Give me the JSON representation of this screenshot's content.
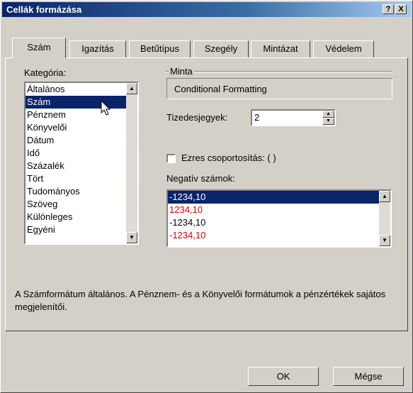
{
  "window": {
    "title": "Cellák formázása",
    "help_label": "?",
    "close_label": "X"
  },
  "tabs": [
    {
      "label": "Szám"
    },
    {
      "label": "Igazítás"
    },
    {
      "label": "Betűtípus"
    },
    {
      "label": "Szegély"
    },
    {
      "label": "Mintázat"
    },
    {
      "label": "Védelem"
    }
  ],
  "category": {
    "label": "Kategória:",
    "items": [
      "Általános",
      "Szám",
      "Pénznem",
      "Könyvelői",
      "Dátum",
      "Idő",
      "Százalék",
      "Tört",
      "Tudományos",
      "Szöveg",
      "Különleges",
      "Egyéni"
    ],
    "selected": "Szám"
  },
  "sample": {
    "label": "Minta",
    "value": "Conditional Formatting"
  },
  "decimals": {
    "label": "Tizedesjegyek:",
    "value": "2"
  },
  "thousands": {
    "label": "Ezres csoportosítás: ( )",
    "checked": false
  },
  "negative": {
    "label": "Negatív számok:",
    "items": [
      {
        "text": "-1234,10",
        "color": "#000000"
      },
      {
        "text": "1234,10",
        "color": "#e00000"
      },
      {
        "text": "-1234,10",
        "color": "#000000"
      },
      {
        "text": "-1234,10",
        "color": "#e00000"
      }
    ]
  },
  "description": "A Számformátum általános. A Pénznem- és a Könyvelői formátumok a pénzértékek sajátos megjelenítői.",
  "buttons": {
    "ok": "OK",
    "cancel": "Mégse"
  }
}
